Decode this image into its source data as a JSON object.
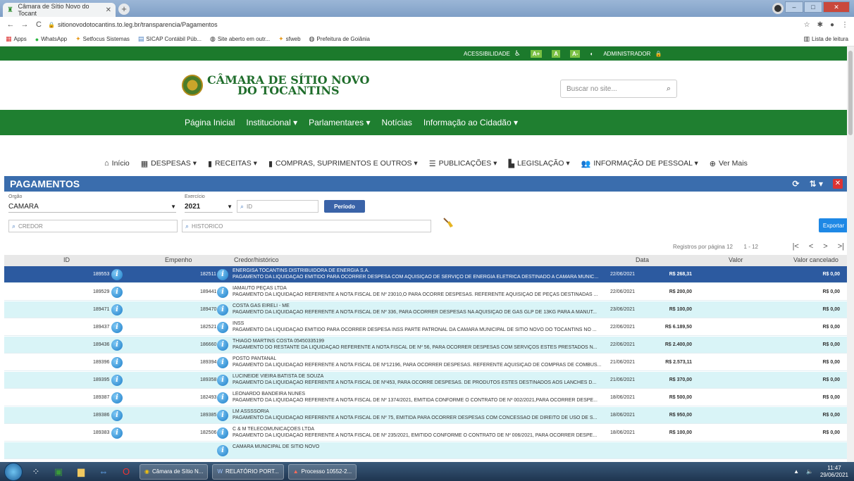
{
  "browser": {
    "tab_title": "Câmara de Sítio Novo do Tocant",
    "url": "sitionovodotocantins.to.leg.br/transparencia/Pagamentos",
    "bookmarks": [
      "Apps",
      "WhatsApp",
      "Setfocus Sistemas",
      "SICAP Contábil Púb...",
      "Site aberto em outr...",
      "sfweb",
      "Prefeitura de Goiânia"
    ],
    "reading_list": "Lista de leitura"
  },
  "accessibility_bar": {
    "acessibilidade": "ACESSIBILIDADE",
    "font_plus": "A+",
    "font_normal": "A",
    "font_minus": "A-",
    "admin": "ADMINISTRADOR"
  },
  "header": {
    "logo_line1": "CÂMARA DE SÍTIO NOVO",
    "logo_line2": "DO TOCANTINS",
    "search_placeholder": "Buscar no site..."
  },
  "main_nav": [
    "Página Inicial",
    "Institucional ▾",
    "Parlamentares ▾",
    "Notícias",
    "Informação ao Cidadão ▾"
  ],
  "sub_nav": [
    {
      "icon": "home-icon",
      "label": "Início"
    },
    {
      "icon": "calculator-icon",
      "label": "DESPESAS ▾"
    },
    {
      "icon": "bar-chart-icon",
      "label": "RECEITAS ▾"
    },
    {
      "icon": "bar-chart-icon",
      "label": "COMPRAS, SUPRIMENTOS E OUTROS ▾"
    },
    {
      "icon": "list-icon",
      "label": "PUBLICAÇÕES ▾"
    },
    {
      "icon": "document-icon",
      "label": "LEGISLAÇÃO ▾"
    },
    {
      "icon": "people-icon",
      "label": "INFORMAÇÃO DE PESSOAL ▾"
    },
    {
      "icon": "plus-circle-icon",
      "label": "Ver Mais"
    }
  ],
  "panel": {
    "title": "PAGAMENTOS"
  },
  "filters": {
    "orgao_label": "Orgão",
    "orgao_value": "CAMARA",
    "exercicio_label": "Exercício",
    "exercicio_value": "2021",
    "id_placeholder": "ID",
    "periodo_button": "Período",
    "credor_placeholder": "CREDOR",
    "historico_placeholder": "HISTORICO",
    "exportar_button": "Exportar"
  },
  "pager": {
    "per_page_label": "Registros por página",
    "per_page": "12",
    "range": "1 - 12"
  },
  "table": {
    "headers": [
      "ID",
      "Empenho",
      "Credor/histórico",
      "Data",
      "Valor",
      "Valor cancelado"
    ],
    "rows": [
      {
        "id": "189553",
        "empenho": "182511",
        "credor": "ENERGISA TOCANTINS DISTRIBUIDORA DE ENERGIA S.A.",
        "historico": "PAGAMENTO DA LIQUIDAÇÃO EMITIDO PARA OCORRER DESPESA COM AQUISIÇÃO DE SERVIÇO DE ENERGIA ELETRICA DESTINADO A CÂMARA MUNIC...",
        "data": "22/06/2021",
        "valor": "R$ 268,31",
        "cancelado": "R$ 0,00"
      },
      {
        "id": "189529",
        "empenho": "189441",
        "credor": "IAMAUTO PEÇAS LTDA",
        "historico": "PAGAMENTO DA LIQUIDAÇÃO REFERENTE A NOTA FISCAL DE Nº 23010,O PARA OCORRE DESPESAS. REFERENTE AQUISIÇÃO DE PEÇAS DESTINADAS ...",
        "data": "22/06/2021",
        "valor": "R$ 200,00",
        "cancelado": "R$ 0,00"
      },
      {
        "id": "189471",
        "empenho": "189470",
        "credor": "COSTA GAS EIRELI - ME",
        "historico": "PAGAMENTO DA LIQUIDAÇÃO REFERENTE A NOTA FISCAL DE Nº 336, PARA OCORRER DESPESAS NA AQUISIÇÃO DE GÁS GLP DE 13KG PARA A MANUT...",
        "data": "23/06/2021",
        "valor": "R$ 100,00",
        "cancelado": "R$ 0,00"
      },
      {
        "id": "189437",
        "empenho": "182521",
        "credor": "INSS",
        "historico": "PAGAMENTO DA LIQUIDAÇÃO EMITIDO PARA OCORRER DESPESA INSS PARTE PATRONAL DA CÂMARA MUNICIPAL DE SÍTIO NOVO DO TOCANTINS NO ...",
        "data": "22/06/2021",
        "valor": "R$ 6.189,50",
        "cancelado": "R$ 0,00"
      },
      {
        "id": "189436",
        "empenho": "186660",
        "credor": "THIAGO MARTINS COSTA 05450335199",
        "historico": "PAGAMENTO DO RESTANTE DA LIQUIDAÇÃO REFERENTE A NOTA FISCAL DE Nº 56, PARA OCORRER DESPESAS COM SERVIÇOS ESTES PRESTADOS N...",
        "data": "22/06/2021",
        "valor": "R$ 2.400,00",
        "cancelado": "R$ 0,00"
      },
      {
        "id": "189396",
        "empenho": "189394",
        "credor": "POSTO PANTANAL",
        "historico": "PAGAMENTO DA LIQUIDAÇÃO REFERENTE A NOTA FISCAL DE Nº12196, PARA OCORRER DESPESAS. REFERENTE AQUISIÇÃO DE COMPRAS DE COMBUS...",
        "data": "21/06/2021",
        "valor": "R$ 2.573,11",
        "cancelado": "R$ 0,00"
      },
      {
        "id": "189395",
        "empenho": "189358",
        "credor": "LUCINEIDE VIEIRA BATISTA DE SOUZA",
        "historico": "PAGAMENTO DA LIQUIDAÇÃO REFERENTE A NOTA FISCAL DE Nº453, PARA OCORRE DESPESAS. DE PRODUTOS ESTES DESTINADOS AOS LANCHES D...",
        "data": "21/06/2021",
        "valor": "R$ 370,00",
        "cancelado": "R$ 0,00"
      },
      {
        "id": "189387",
        "empenho": "182493",
        "credor": "LEONARDO BANDEIRA NUNES",
        "historico": "PAGAMENTO DA LIQUIDAÇÃO REFERENTE A NOTA FISCAL DE Nº 1374/2021, EMITIDA CONFORME O CONTRATO DE Nº 002/2021,PARA OCORRER DESPE...",
        "data": "18/06/2021",
        "valor": "R$ 500,00",
        "cancelado": "R$ 0,00"
      },
      {
        "id": "189386",
        "empenho": "189385",
        "credor": "LM ASSSSORIA",
        "historico": "PAGAMENTO DA LIQUIDAÇÃO REFERENTE A NOTA FISCAL DE Nº 75, EMITIDA PARA OCORRER DESPESAS COM CONCESSÃO DE DIREITO DE USO DE S...",
        "data": "18/06/2021",
        "valor": "R$ 950,00",
        "cancelado": "R$ 0,00"
      },
      {
        "id": "189383",
        "empenho": "182506",
        "credor": "C & M TELECOMUNICAÇÕES LTDA",
        "historico": "PAGAMENTO DA LIQUIDAÇÃO REFERENTE A NOTA FISCAL DE Nº 235/2021, EMITIDO CONFORME O CONTRATO DE Nº 006/2021, PARA OCORRER DESPE...",
        "data": "18/06/2021",
        "valor": "R$ 100,00",
        "cancelado": "R$ 0,00"
      },
      {
        "id": "",
        "empenho": "",
        "credor": "CÂMARA MUNICIPAL DE SÍTIO NOVO",
        "historico": "",
        "data": "",
        "valor": "",
        "cancelado": ""
      }
    ]
  },
  "taskbar": {
    "apps": [
      "Câmara de Sítio N...",
      "RELATÓRIO PORT...",
      "Processo 10552-2..."
    ],
    "time": "11:47",
    "date": "29/06/2021"
  }
}
